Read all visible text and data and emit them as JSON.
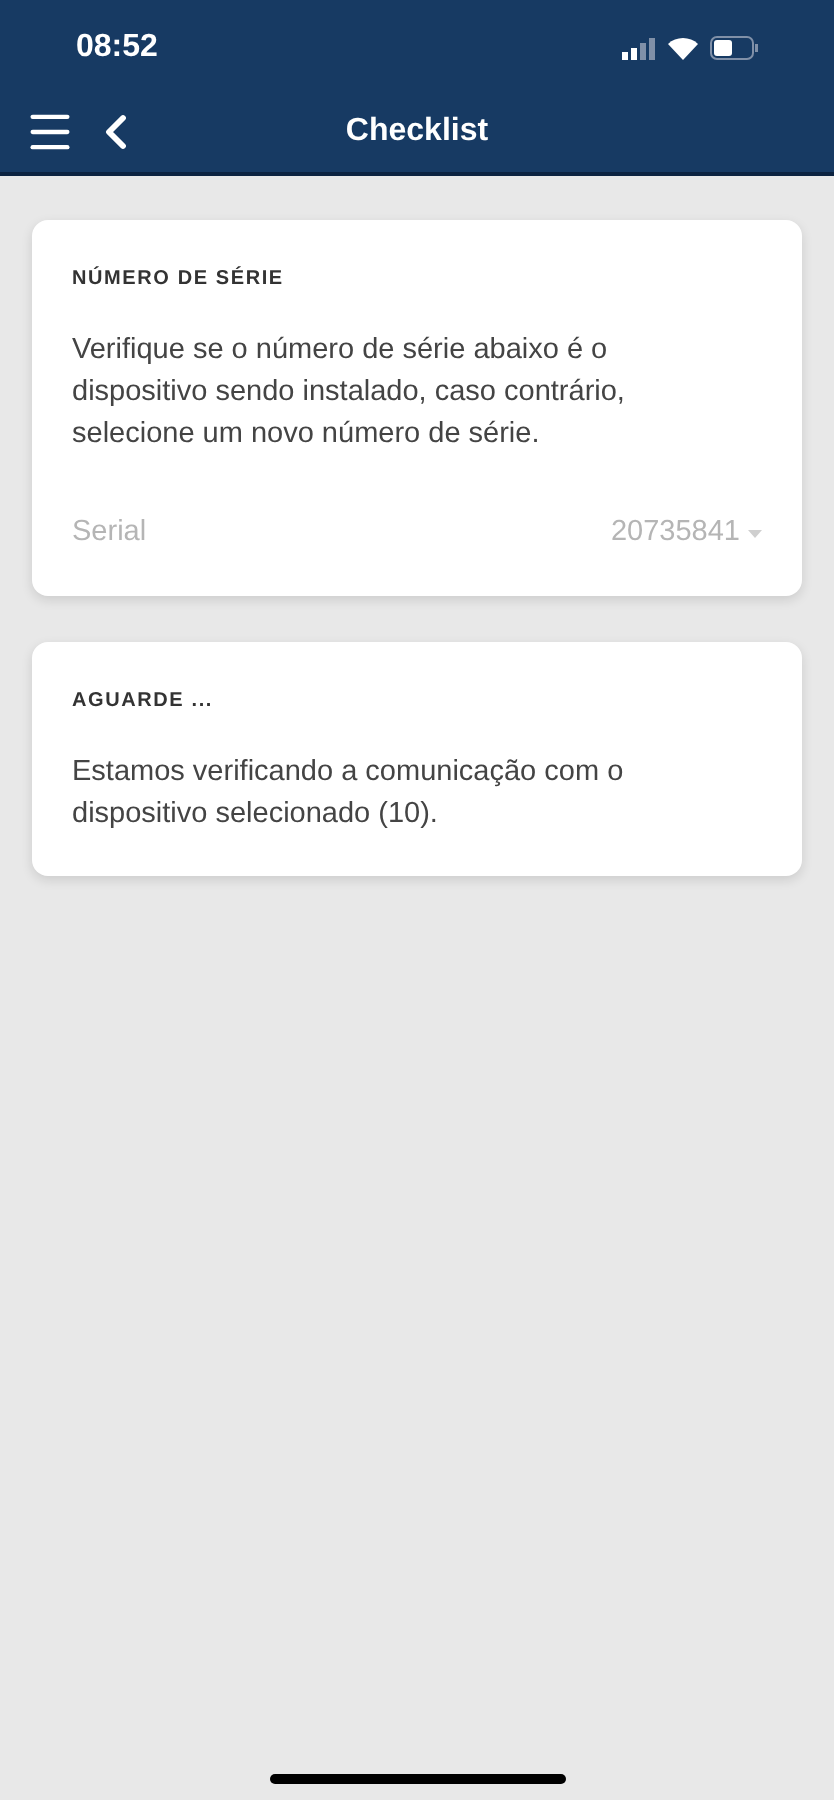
{
  "status_bar": {
    "time": "08:52"
  },
  "nav_bar": {
    "title": "Checklist"
  },
  "cards": [
    {
      "kind": "select",
      "heading": "NÚMERO DE SÉRIE",
      "text": "Verifique se o número de série abaixo é o dispositivo sendo instalado, caso contrário, selecione um novo número de série.",
      "field": {
        "label": "Serial",
        "value": "20735841"
      }
    },
    {
      "kind": "message",
      "heading": "AGUARDE ...",
      "text": "Estamos verificando a comunicação com o dispositivo selecionado (10)."
    }
  ]
}
